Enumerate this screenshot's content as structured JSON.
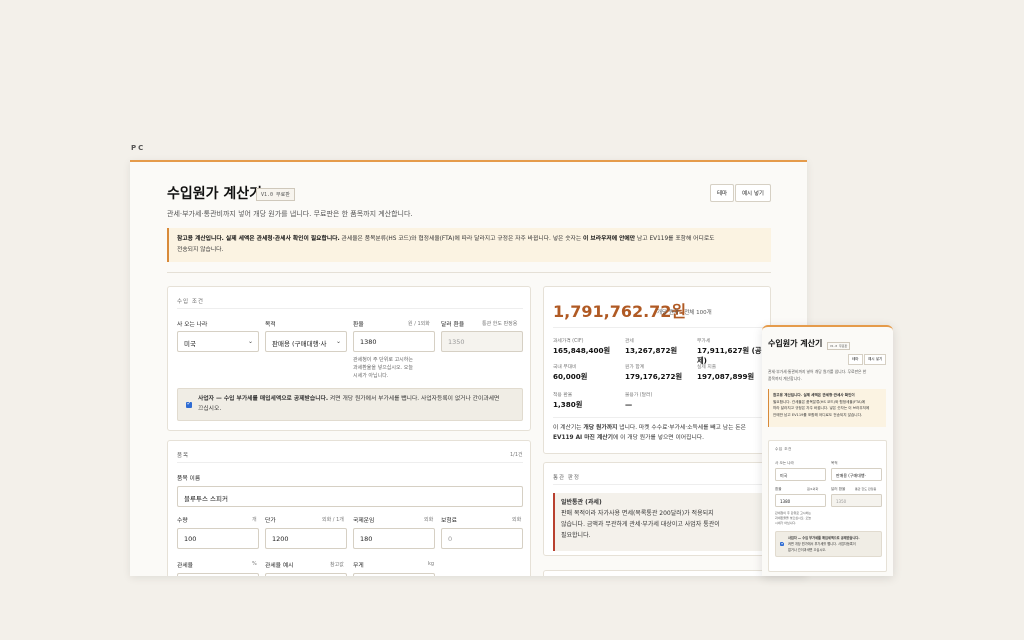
{
  "device_label": "PC",
  "app": {
    "title": "수입원가 계산기",
    "version": "V1.0 무료판",
    "subtitle": "관세·부가세·통관비까지 넣어 개당 원가를 냅니다. 무료판은 한 품목까지 계산합니다.",
    "theme_button": "테마",
    "example_button": "예시 넣기"
  },
  "notice": {
    "bold1": "참고용 계산입니다. 실제 세액은 관세청·관세사 확인이 필요합니다.",
    "text1": " 관세율은 품목분류(HS 코드)와 협정세율(FTA)에 따라 달라지고 규정은 자주 바뀝니다. 넣은 숫자는 ",
    "bold2": "이 브라우저에 안에만",
    "text2": " 남고 EV119를 포함해 어디로도",
    "line2": "전송되지 않습니다."
  },
  "import_conditions": {
    "section_title": "수입 조건",
    "country_label": "사 오는 나라",
    "country_value": "미국",
    "purpose_label": "목적",
    "purpose_value": "판매용 (구매대행·사",
    "fx_label": "환율",
    "fx_unit": "원 / 1외화",
    "fx_value": "1380",
    "usd_fx_label": "달러 환율",
    "usd_fx_unit": "통관 한도 판정용",
    "usd_fx_placeholder": "1350",
    "fx_hint": [
      "관세청이 주 단위로 고시하는",
      "과세환율을 넣으십시오. 오늘",
      "시세가 아닙니다."
    ],
    "business_checked": true,
    "business_bold": "사업자 — 수입 부가세를 매입세액으로 공제받습니다.",
    "business_text": " 켜면 개당 원가에서 부가세를 뺍니다. 사업자등록이 없거나 간이과세면",
    "business_line2": "끄십시오."
  },
  "item": {
    "section_title": "품목",
    "count": "1/1건",
    "name_label": "품목 이름",
    "name_value": "블루투스 스피커",
    "qty_label": "수량",
    "qty_unit": "개",
    "qty_value": "100",
    "price_label": "단가",
    "price_unit": "외화 / 1개",
    "price_value": "1200",
    "freight_label": "국제운임",
    "freight_unit": "외화",
    "freight_value": "180",
    "insurance_label": "보험료",
    "insurance_unit": "외화",
    "insurance_placeholder": "0",
    "tariff_label": "관세율",
    "tariff_unit": "%",
    "tariff_example_label": "관세율 예시",
    "tariff_example_unit": "참고값",
    "weight_label": "무게",
    "weight_unit": "kg"
  },
  "result": {
    "unit_cost": "1,791,762.72원",
    "unit_cost_caption": "개당 원가 · 전체 100개",
    "stats": [
      {
        "label": "과세가격 (CIF)",
        "value": "165,848,400원"
      },
      {
        "label": "관세",
        "value": "13,267,872원"
      },
      {
        "label": "부가세",
        "value": "17,911,627원 (공제)"
      },
      {
        "label": "국내 부대비",
        "value": "60,000원"
      },
      {
        "label": "원가 합계",
        "value": "179,176,272원"
      },
      {
        "label": "실제 지출",
        "value": "197,087,899원"
      },
      {
        "label": "적용 환율",
        "value": "1,380원"
      },
      {
        "label": "불용가 (달러)",
        "value": "—"
      }
    ],
    "explain_1": "이 계산기는 ",
    "explain_bold1": "개당 원가까지",
    "explain_2": " 냅니다. 마켓 수수료·부가세·소득세를 빼고 남는 돈은",
    "explain_bold2": "EV119 AI 마진 계산기",
    "explain_3": "에 이 개당 원가를 넣으면 이어집니다."
  },
  "customs": {
    "section_title": "통관 판정",
    "heading": "일반통관 (과세)",
    "lines": [
      "판매 목적이라 자가사용 면세(목록통관 200달러)가 적용되지",
      "않습니다. 금액과 무관하게 관세·부가세 대상이고 사업자 통관이",
      "필요합니다."
    ]
  },
  "mobile": {
    "title": "수입원가 계산기",
    "version": "V1.0 무료판",
    "theme_button": "테마",
    "example_button": "예시 넣기",
    "subtitle": [
      "관세·부가세·통관비까지 넣어 개당 원가를 냅니다. 무료판은 한",
      "품목까지 계산합니다."
    ],
    "notice": [
      "참고용 계산입니다. 실제 세액은 관세청·관세사 확인이",
      "필요합니다. 관세율은 품목분류(HS 코드)와 협정세율(FTA)에",
      "따라 달라지고 규정은 자주 바뀝니다. 넣은 숫자는 이 브라우저에",
      "안에만 남고 EV119를 포함해 어디로도 전송되지 않습니다."
    ],
    "section_title": "수입 조건",
    "country_label": "사 오는 나라",
    "country_value": "미국",
    "purpose_label": "목적",
    "purpose_value": "판매용 (구매대행·",
    "fx_label": "환율",
    "fx_unit": "원/1외화",
    "fx_value": "1380",
    "usd_label": "달러 환율",
    "usd_unit": "통관 한도 판정용",
    "usd_placeholder": "1350",
    "fx_hint": [
      "관세청이 주 단위로 고시하는",
      "과세환율을 넣으십시오. 오늘",
      "시세가 아닙니다."
    ],
    "business": [
      "사업자 — 수입 부가세를 매입세액으로 공제받습니다.",
      "켜면 개당 원가에서 부가세를 뺍니다. 사업자등록이",
      "없거나 간이과세면 끄십시오."
    ]
  }
}
